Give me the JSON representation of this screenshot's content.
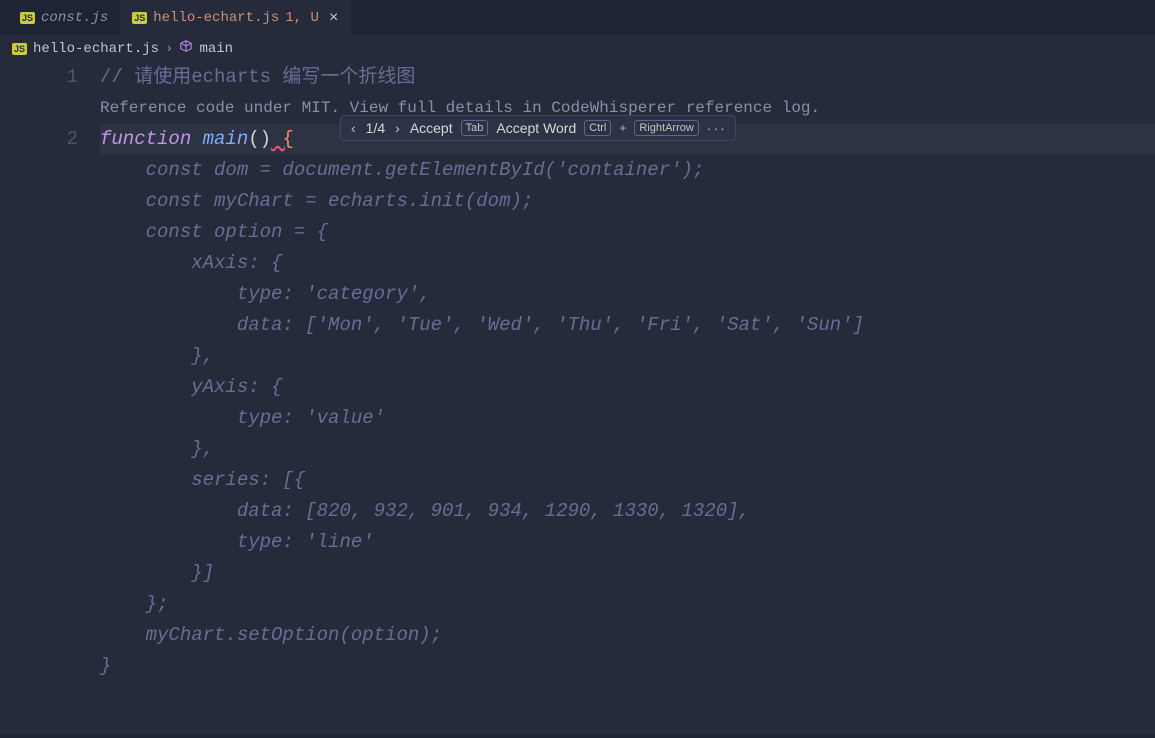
{
  "tabs": [
    {
      "label": "const.js",
      "active": false
    },
    {
      "label": "hello-echart.js",
      "status": "1, U",
      "active": true
    }
  ],
  "breadcrumb": {
    "file": "hello-echart.js",
    "symbol": "main"
  },
  "gutter": [
    "1",
    "",
    "2",
    "",
    "",
    "",
    "",
    "",
    "",
    "",
    "",
    "",
    "",
    "",
    "",
    "",
    "",
    "",
    "",
    ""
  ],
  "suggestion": {
    "counter": "1/4",
    "accept_label": "Accept",
    "accept_key": "Tab",
    "accept_word_label": "Accept Word",
    "accept_word_key1": "Ctrl",
    "accept_word_plus": "+",
    "accept_word_key2": "RightArrow",
    "more": "···"
  },
  "code": {
    "line1_comment": "// 请使用echarts 编写一个折线图",
    "reference": "Reference code under MIT. View full details in CodeWhisperer reference log.",
    "line2_kw": "function",
    "line2_name": " main",
    "line2_parens": "()",
    "line2_brace": " {",
    "ghost_lines": [
      "    const dom = document.getElementById('container');",
      "    const myChart = echarts.init(dom);",
      "    const option = {",
      "        xAxis: {",
      "            type: 'category',",
      "            data: ['Mon', 'Tue', 'Wed', 'Thu', 'Fri', 'Sat', 'Sun']",
      "        },",
      "        yAxis: {",
      "            type: 'value'",
      "        },",
      "        series: [{",
      "            data: [820, 932, 901, 934, 1290, 1330, 1320],",
      "            type: 'line'",
      "        }]",
      "    };",
      "    myChart.setOption(option);",
      "}"
    ]
  }
}
